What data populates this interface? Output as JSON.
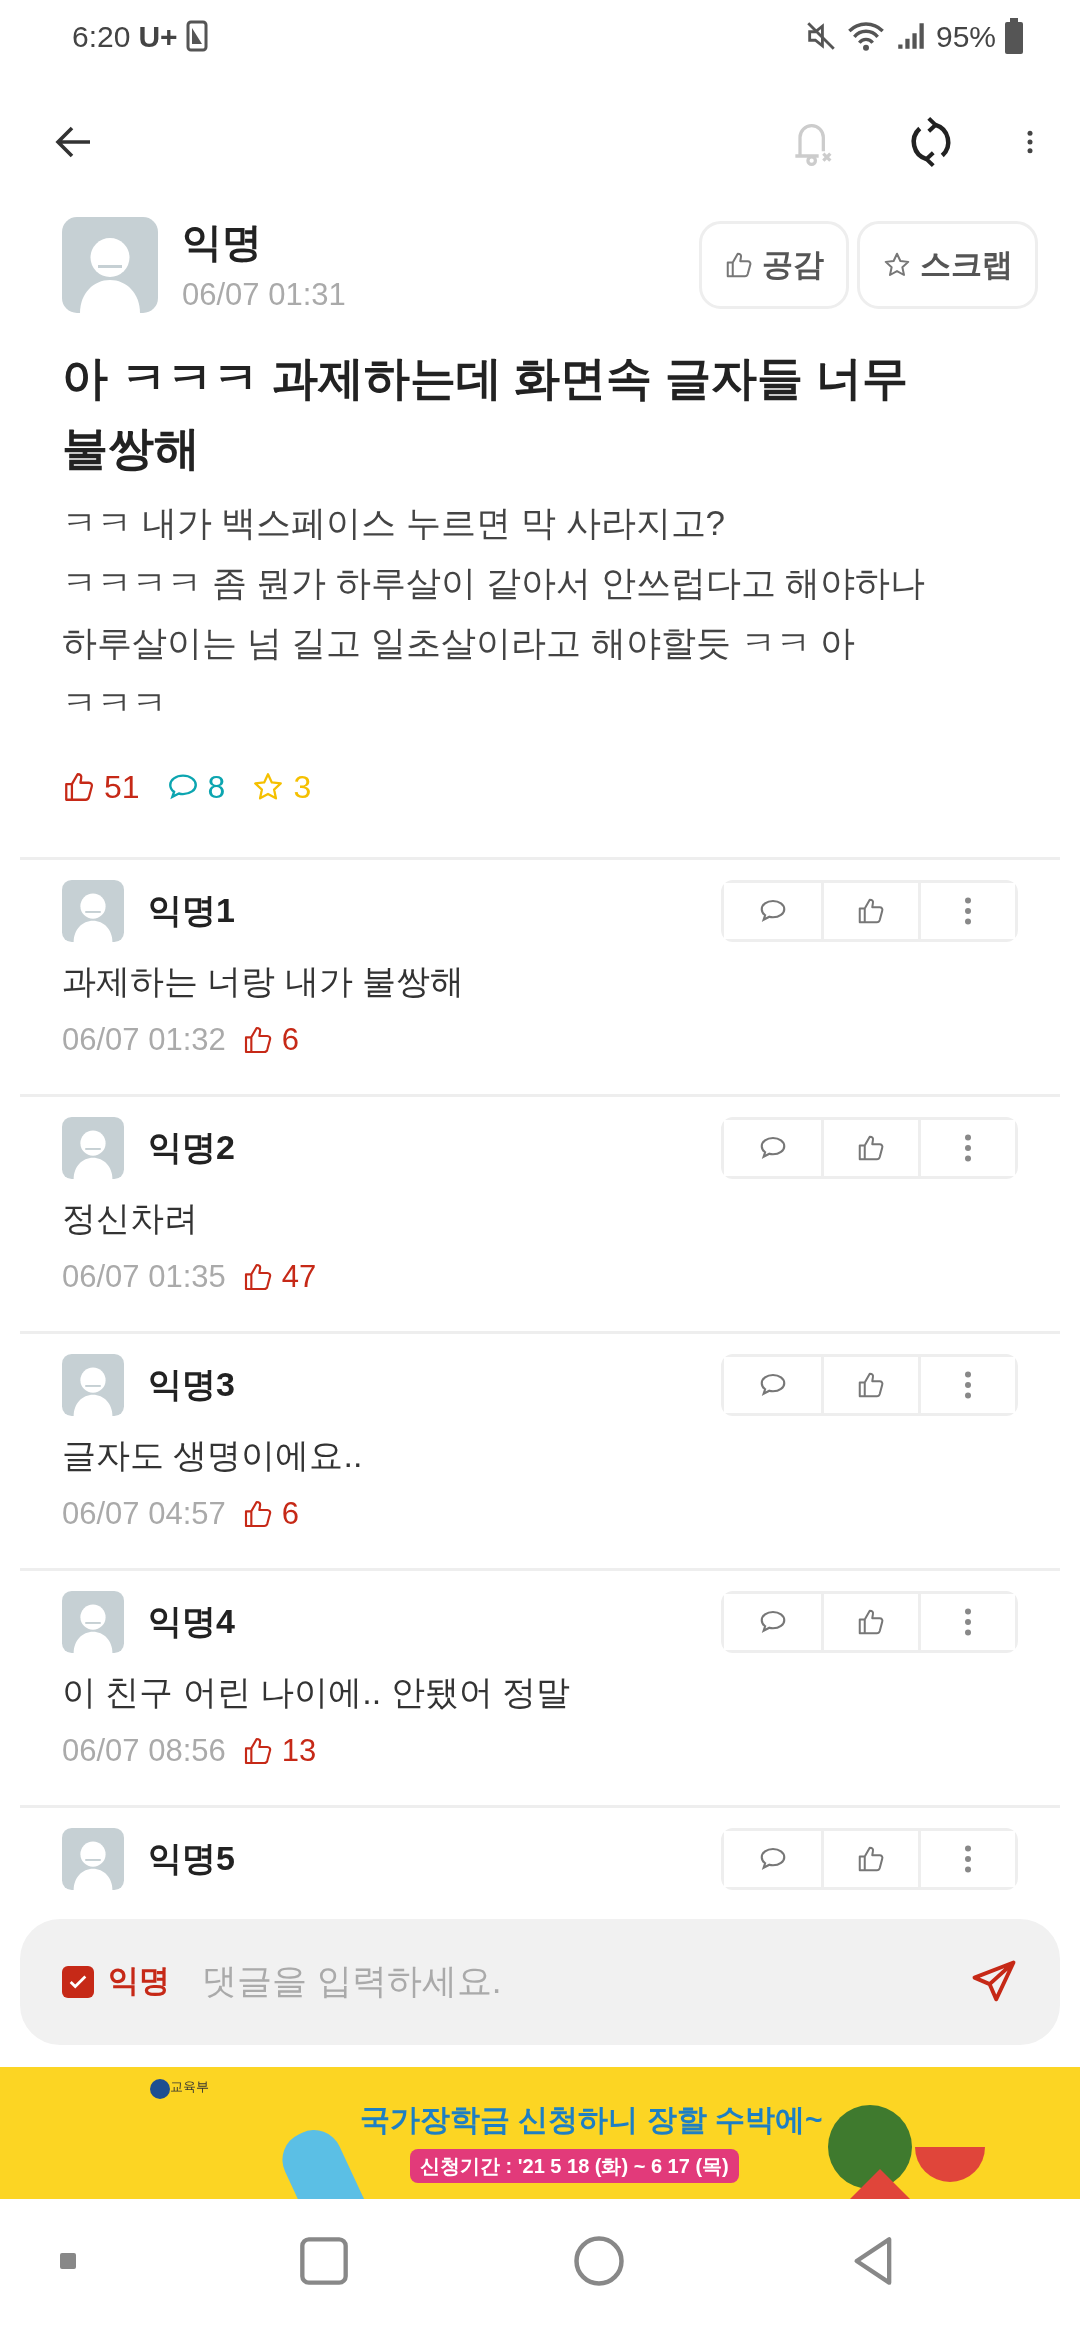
{
  "status_bar": {
    "time": "6:20",
    "carrier": "U+",
    "battery": "95%"
  },
  "post": {
    "author": "익명",
    "time": "06/07 01:31",
    "buttons": [
      {
        "kind": "like",
        "label": "공감"
      },
      {
        "kind": "scrap",
        "label": "스크랩"
      }
    ],
    "title": "아 ㅋㅋㅋ 과제하는데 화면속 글자들 너무 불쌍해",
    "body": "ㅋㅋ 내가 백스페이스 누르면 막 사라지고?\nㅋㅋㅋㅋ 좀 뭔가 하루살이 같아서 안쓰럽다고 해야하나\n하루살이는 넘 길고 일초살이라고 해야할듯 ㅋㅋ 아\nㅋㅋㅋ",
    "likes": "51",
    "comments": "8",
    "scraps": "3"
  },
  "comments": [
    {
      "author": "익명1",
      "text": "과제하는 너랑 내가 불쌍해",
      "time": "06/07 01:32",
      "likes": "6"
    },
    {
      "author": "익명2",
      "text": "정신차려",
      "time": "06/07 01:35",
      "likes": "47"
    },
    {
      "author": "익명3",
      "text": "글자도 생명이에요..",
      "time": "06/07 04:57",
      "likes": "6"
    },
    {
      "author": "익명4",
      "text": "이 친구 어린 나이에.. 안됐어 정말",
      "time": "06/07 08:56",
      "likes": "13"
    },
    {
      "author": "익명5"
    }
  ],
  "comment_input": {
    "anonymous": true,
    "anonymous_label": "익명",
    "placeholder": "댓글을 입력하세요."
  },
  "ad": {
    "org": "교육부",
    "slogan": "국가장학금 신청하니 장할 수박에~",
    "period": "신청기간 : '21 5 18 (화) ~ 6 17 (목)"
  }
}
